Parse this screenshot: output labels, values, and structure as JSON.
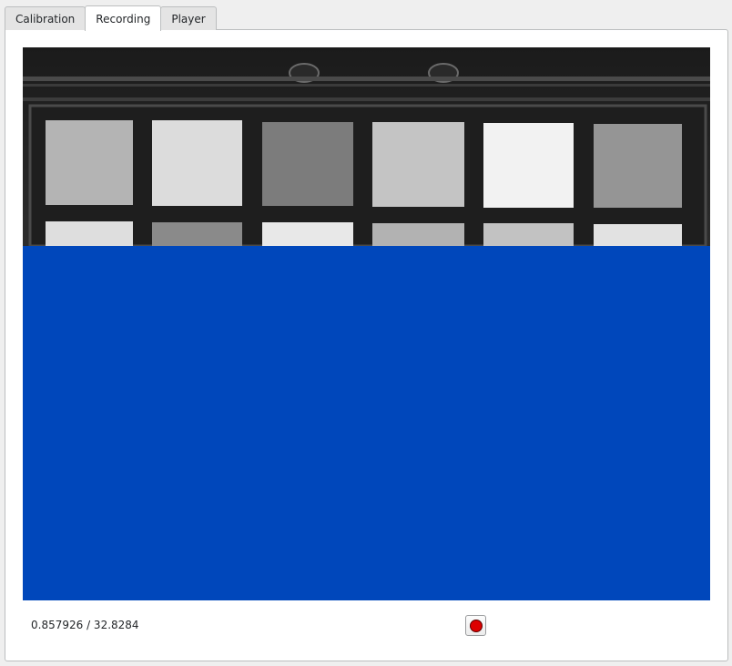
{
  "tabs": [
    {
      "label": "Calibration",
      "active": false
    },
    {
      "label": "Recording",
      "active": true
    },
    {
      "label": "Player",
      "active": false
    }
  ],
  "recording": {
    "readout": "0.857926 / 32.8284",
    "record_icon": "record-icon"
  },
  "colors": {
    "video_background": "#0047bb",
    "record_dot": "#dd0000"
  }
}
